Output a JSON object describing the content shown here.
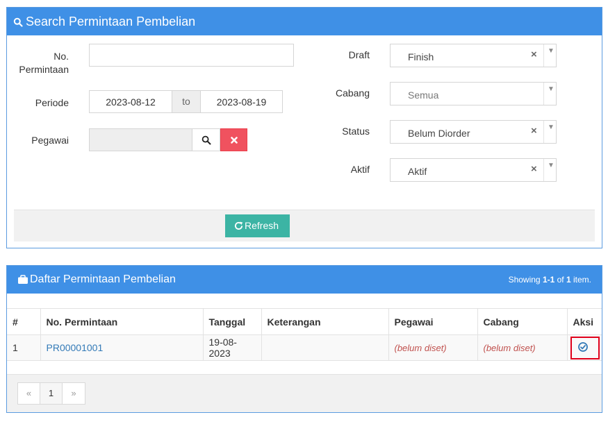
{
  "search_panel": {
    "title": "Search Permintaan Pembelian",
    "fields": {
      "no_permintaan_label_1": "No.",
      "no_permintaan_label_2": "Permintaan",
      "no_permintaan_value": "",
      "periode_label": "Periode",
      "periode_from": "2023-08-12",
      "periode_to_text": "to",
      "periode_to": "2023-08-19",
      "pegawai_label": "Pegawai",
      "pegawai_value": ""
    },
    "selects": {
      "draft_label": "Draft",
      "draft_value": "Finish",
      "cabang_label": "Cabang",
      "cabang_value": "Semua",
      "status_label": "Status",
      "status_value": "Belum Diorder",
      "aktif_label": "Aktif",
      "aktif_value": "Aktif"
    },
    "refresh_label": "Refresh"
  },
  "list_panel": {
    "title": "Daftar Permintaan Pembelian",
    "summary_prefix": "Showing ",
    "summary_range": "1-1",
    "summary_of": " of ",
    "summary_total": "1",
    "summary_suffix": " item.",
    "columns": [
      "#",
      "No. Permintaan",
      "Tanggal",
      "Keterangan",
      "Pegawai",
      "Cabang",
      "Aksi"
    ],
    "rows": [
      {
        "num": "1",
        "no_permintaan": "PR00001001",
        "tanggal": "19-08-2023",
        "keterangan": "",
        "pegawai": "(belum diset)",
        "cabang": "(belum diset)"
      }
    ],
    "pager": {
      "prev": "«",
      "page": "1",
      "next": "»"
    }
  },
  "colors": {
    "panel_header": "#3f90e6",
    "refresh_button": "#3cb4a4",
    "clear_button": "#f0525f",
    "highlight_frame": "#e0001b"
  },
  "icons": {
    "search_header": "search-icon",
    "list_header": "briefcase-icon",
    "pegawai_search": "search-icon",
    "pegawai_clear": "close-icon",
    "refresh": "refresh-icon",
    "action": "check-circle-icon"
  }
}
